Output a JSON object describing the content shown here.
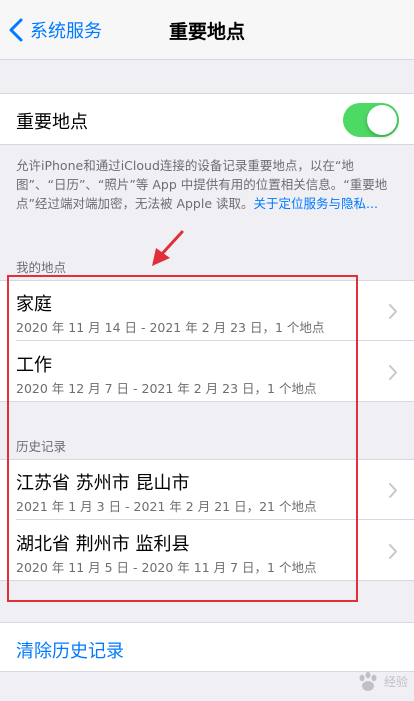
{
  "nav": {
    "back_label": "系统服务",
    "title": "重要地点"
  },
  "toggle": {
    "label": "重要地点",
    "enabled": true,
    "on_color": "#4cd964"
  },
  "footnote": {
    "text": "允许iPhone和通过iCloud连接的设备记录重要地点，以在“地图”、“日历”、“照片”等 App 中提供有用的位置相关信息。“重要地点”经过端对端加密，无法被 Apple 读取。",
    "link": "关于定位服务与隐私..."
  },
  "my_places": {
    "header": "我的地点",
    "items": [
      {
        "title": "家庭",
        "subtitle": "2020 年 11 月 14 日 - 2021 年 2 月 23 日，1 个地点"
      },
      {
        "title": "工作",
        "subtitle": "2020 年 12 月 7 日 - 2021 年 2 月 23 日，1 个地点"
      }
    ]
  },
  "history": {
    "header": "历史记录",
    "items": [
      {
        "title": "江苏省 苏州市 昆山市",
        "subtitle": "2021 年 1 月 3 日 - 2021 年 2 月 21 日，21 个地点"
      },
      {
        "title": "湖北省 荆州市 监利县",
        "subtitle": "2020 年 11 月 5 日 - 2020 年 11 月 7 日，1 个地点"
      }
    ]
  },
  "clear_history": {
    "label": "清除历史记录"
  },
  "colors": {
    "accent": "#007aff",
    "background": "#efeff4",
    "annotation": "#e0303a"
  },
  "watermark": {
    "text": "经验"
  }
}
